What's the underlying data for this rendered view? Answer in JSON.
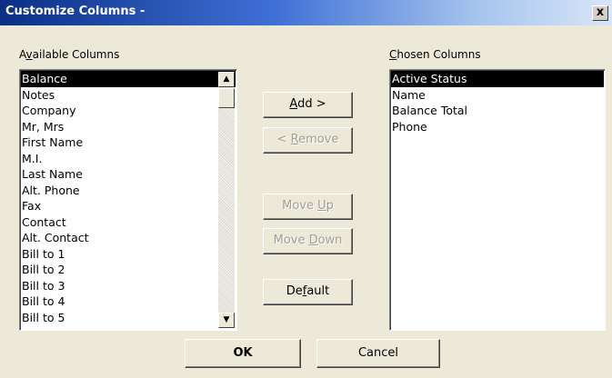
{
  "window": {
    "title": "Customize Columns -",
    "close_label": "x"
  },
  "available": {
    "label_pre": "A",
    "label_mn": "v",
    "label_post": "ailable Columns",
    "items": [
      "Balance",
      "Notes",
      "Company",
      "Mr, Mrs",
      "First Name",
      "M.I.",
      "Last Name",
      "Alt. Phone",
      "Fax",
      "Contact",
      "Alt. Contact",
      "Bill to 1",
      "Bill to 2",
      "Bill to 3",
      "Bill to 4",
      "Bill to 5"
    ],
    "selected_index": 0
  },
  "chosen": {
    "label_pre": "",
    "label_mn": "C",
    "label_post": "hosen Columns",
    "items": [
      "Active Status",
      "Name",
      "Balance Total",
      "Phone"
    ],
    "selected_index": 0
  },
  "buttons": {
    "add": {
      "pre": "",
      "mn": "A",
      "post": "dd >"
    },
    "remove": {
      "pre": "< ",
      "mn": "R",
      "post": "emove"
    },
    "move_up": {
      "pre": "Move ",
      "mn": "U",
      "post": "p"
    },
    "move_down": {
      "pre": "Move ",
      "mn": "D",
      "post": "own"
    },
    "default": {
      "pre": "De",
      "mn": "f",
      "post": "ault"
    },
    "ok": "OK",
    "cancel": "Cancel"
  },
  "icons": {
    "scroll_up": "▲",
    "scroll_down": "▼"
  }
}
